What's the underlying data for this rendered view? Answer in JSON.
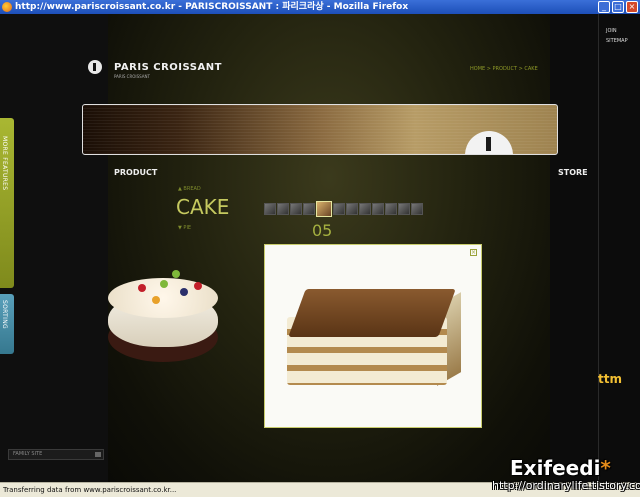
{
  "window": {
    "title": "http://www.pariscroissant.co.kr - PARISCROISSANT : 파리크라상 - Mozilla Firefox",
    "buttons": [
      "_",
      "□",
      "×"
    ]
  },
  "top_nav": {
    "join": "JOIN",
    "sitemap": "SITEMAP"
  },
  "brand": {
    "name": "PARIS CROISSANT",
    "sub": "PARIS CROISSANT"
  },
  "breadcrumb": "HOME > PRODUCT > CAKE",
  "side_tabs": {
    "more_features": "MORE FEATURES",
    "sorting": "SORTING"
  },
  "nav": {
    "product": "PRODUCT",
    "store": "STORE"
  },
  "category": {
    "prev": "▲ BREAD",
    "current": "CAKE",
    "next": "▼ PIE"
  },
  "slide_number": "05",
  "thumbnail_count": 12,
  "selected_thumbnail": 4,
  "close_glyph": "×",
  "family_site": "FAMILY SITE",
  "status_text": "Transferring data from www.pariscroissant.co.kr...",
  "watermark": {
    "brand": "Exifeedi",
    "url": "http://ordinarylife.tistory.com/"
  },
  "badge_text": "ttm",
  "colors": {
    "accent_olive": "#a5b040",
    "tab_green": "#a9b732",
    "tab_blue": "#59a0bb"
  }
}
